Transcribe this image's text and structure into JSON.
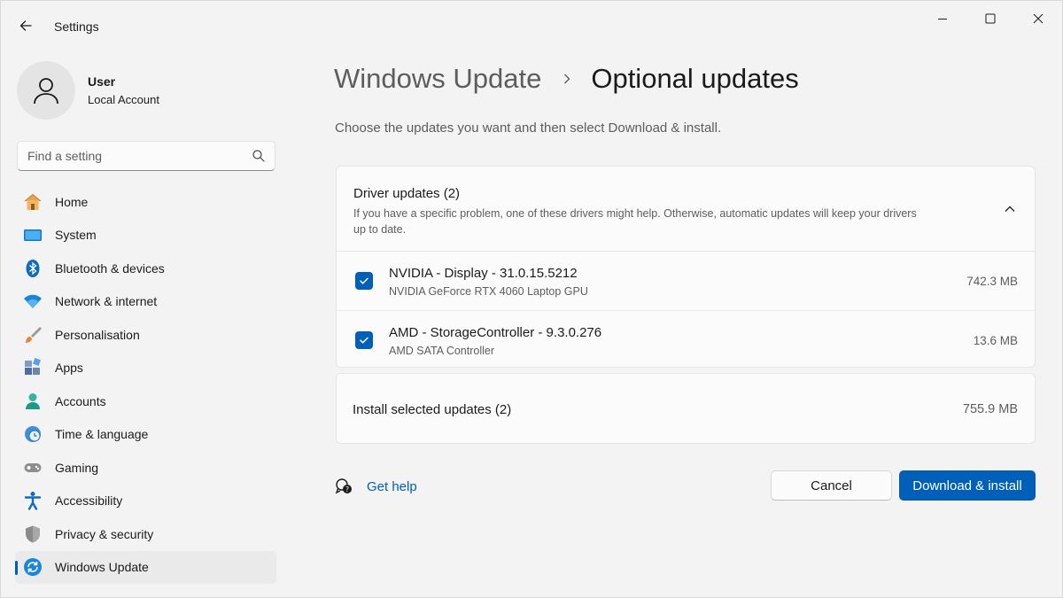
{
  "window": {
    "title": "Settings",
    "controls": {
      "minimize": "minimize-icon",
      "maximize": "maximize-icon",
      "close": "close-icon"
    }
  },
  "profile": {
    "name": "User",
    "account_type": "Local Account"
  },
  "search": {
    "placeholder": "Find a setting"
  },
  "sidebar": {
    "items": [
      {
        "label": "Home",
        "icon": "home-icon"
      },
      {
        "label": "System",
        "icon": "system-icon"
      },
      {
        "label": "Bluetooth & devices",
        "icon": "bluetooth-icon"
      },
      {
        "label": "Network & internet",
        "icon": "wifi-icon"
      },
      {
        "label": "Personalisation",
        "icon": "brush-icon"
      },
      {
        "label": "Apps",
        "icon": "apps-icon"
      },
      {
        "label": "Accounts",
        "icon": "accounts-icon"
      },
      {
        "label": "Time & language",
        "icon": "clock-globe-icon"
      },
      {
        "label": "Gaming",
        "icon": "gamepad-icon"
      },
      {
        "label": "Accessibility",
        "icon": "accessibility-icon"
      },
      {
        "label": "Privacy & security",
        "icon": "shield-icon"
      },
      {
        "label": "Windows Update",
        "icon": "update-icon",
        "active": true
      }
    ]
  },
  "main": {
    "breadcrumb": {
      "parent": "Windows Update",
      "current": "Optional updates"
    },
    "subtitle": "Choose the updates you want and then select Download & install.",
    "driver_section": {
      "title": "Driver updates (2)",
      "description": "If you have a specific problem, one of these drivers might help. Otherwise, automatic updates will keep your drivers up to date.",
      "updates": [
        {
          "name": "NVIDIA - Display - 31.0.15.5212",
          "device": "NVIDIA GeForce RTX 4060 Laptop GPU",
          "size": "742.3 MB",
          "checked": true
        },
        {
          "name": "AMD - StorageController - 9.3.0.276",
          "device": "AMD SATA Controller",
          "size": "13.6 MB",
          "checked": true
        }
      ]
    },
    "install_summary": {
      "label": "Install selected updates (2)",
      "size": "755.9 MB"
    },
    "help_link": "Get help",
    "buttons": {
      "cancel": "Cancel",
      "download_install": "Download & install"
    }
  },
  "colors": {
    "accent": "#005fb8",
    "background": "#f3f3f3",
    "card": "#fbfbfb"
  }
}
